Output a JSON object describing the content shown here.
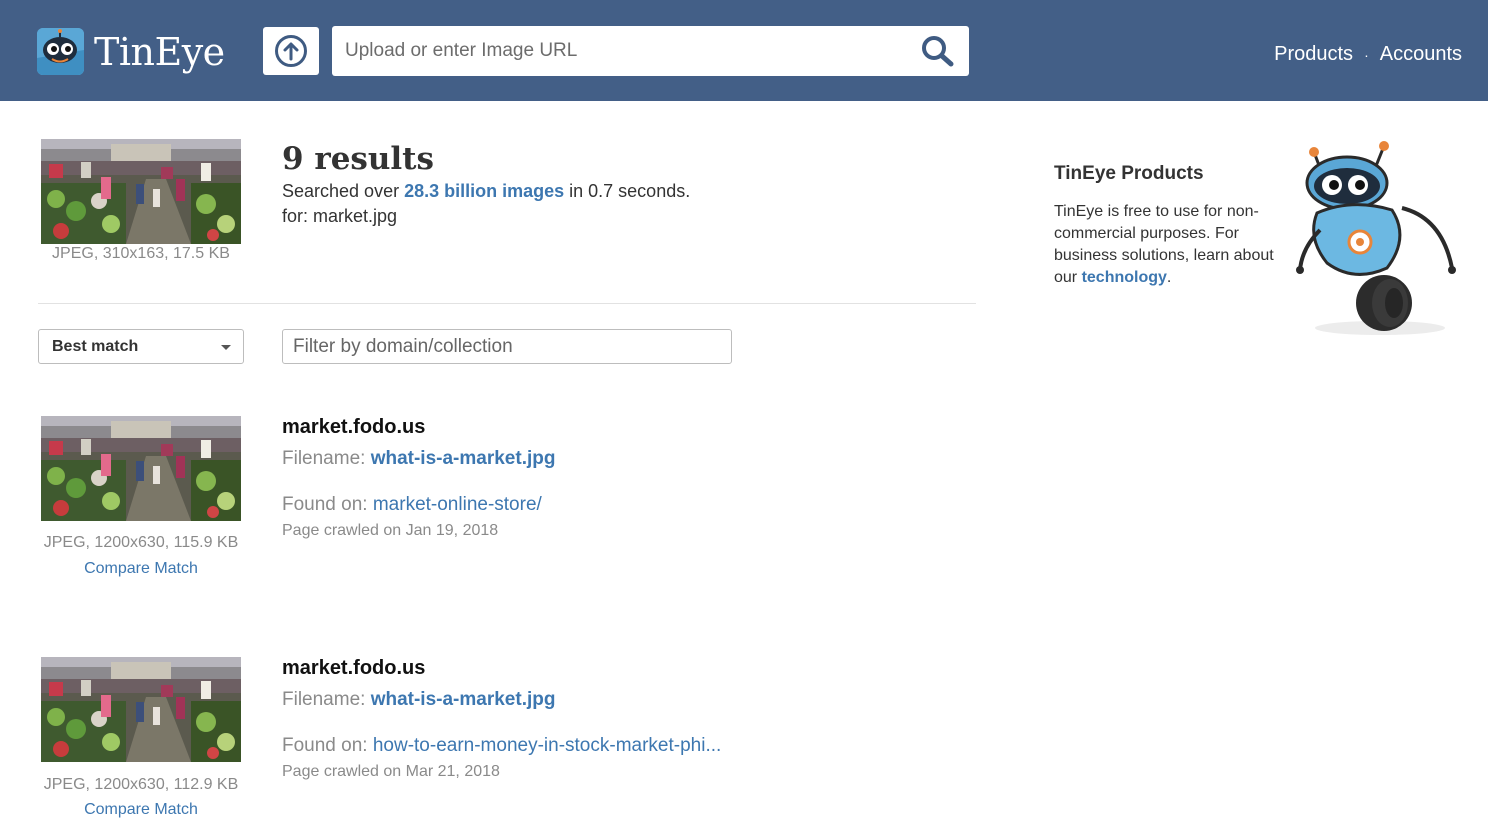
{
  "header": {
    "logo_text": "TinEye",
    "upload_icon": "upload-arrow-icon",
    "search_placeholder": "Upload or enter Image URL",
    "search_icon": "search-icon",
    "nav": {
      "products": "Products",
      "separator": "·",
      "accounts": "Accounts"
    }
  },
  "query": {
    "image_caption": "JPEG, 310x163, 17.5 KB",
    "results_count": "9 results",
    "searched_prefix": "Searched over ",
    "searched_highlight": "28.3 billion images",
    "searched_suffix": " in 0.7 seconds.",
    "for_line": "for: market.jpg"
  },
  "controls": {
    "sort_selected": "Best match",
    "filter_placeholder": "Filter by domain/collection"
  },
  "results": [
    {
      "domain": "market.fodo.us",
      "filename_label": "Filename: ",
      "filename": "what-is-a-market.jpg",
      "found_label": "Found on: ",
      "found": "market-online-store/",
      "crawled": "Page crawled on Jan 19, 2018",
      "image_caption": "JPEG, 1200x630, 115.9 KB",
      "compare": "Compare Match"
    },
    {
      "domain": "market.fodo.us",
      "filename_label": "Filename: ",
      "filename": "what-is-a-market.jpg",
      "found_label": "Found on: ",
      "found": "how-to-earn-money-in-stock-market-phi...",
      "crawled": "Page crawled on Mar 21, 2018",
      "image_caption": "JPEG, 1200x630, 112.9 KB",
      "compare": "Compare Match"
    }
  ],
  "sidebar": {
    "title": "TinEye Products",
    "text_before_link": "TinEye is free to use for non-commercial purposes. For business solutions, learn about our ",
    "link": "technology",
    "text_after_link": "."
  },
  "colors": {
    "header_bg": "#435f87",
    "link": "#3d77b0",
    "muted": "#8a8a8a"
  }
}
